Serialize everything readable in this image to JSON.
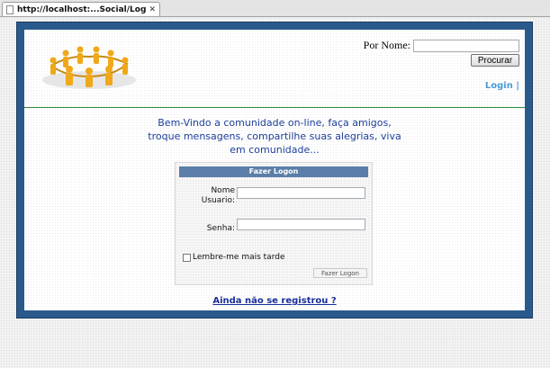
{
  "browser": {
    "tab_title": "http://localhost:...Social/Login.aspx",
    "tab_close": "✕"
  },
  "header": {
    "search_label": "Por Nome:",
    "search_value": "",
    "search_button": "Procurar",
    "login_link": "Login |"
  },
  "welcome": {
    "lines": [
      "Bem-Vindo a comunidade on-line, faça amigos,",
      "troque mensagens, compartilhe suas alegrias, viva",
      "em comunidade..."
    ]
  },
  "login_form": {
    "title": "Fazer Logon",
    "username_label": "Nome Usuario:",
    "username_value": "",
    "password_label": "Senha:",
    "password_value": "",
    "remember_label": "Lembre-me mais tarde",
    "remember_checked": false,
    "submit_label": "Fazer Logon"
  },
  "register_link": "Ainda não se registrou ?",
  "colors": {
    "frame_blue": "#2a5a8c",
    "link_blue": "#4a9ad8",
    "welcome_text": "#1c3f9a",
    "rule_green": "#2f8a3a",
    "form_header": "#5b7ea8"
  },
  "icons": {
    "logo": "people-circle-logo-icon",
    "tab_favicon": "page-icon"
  }
}
